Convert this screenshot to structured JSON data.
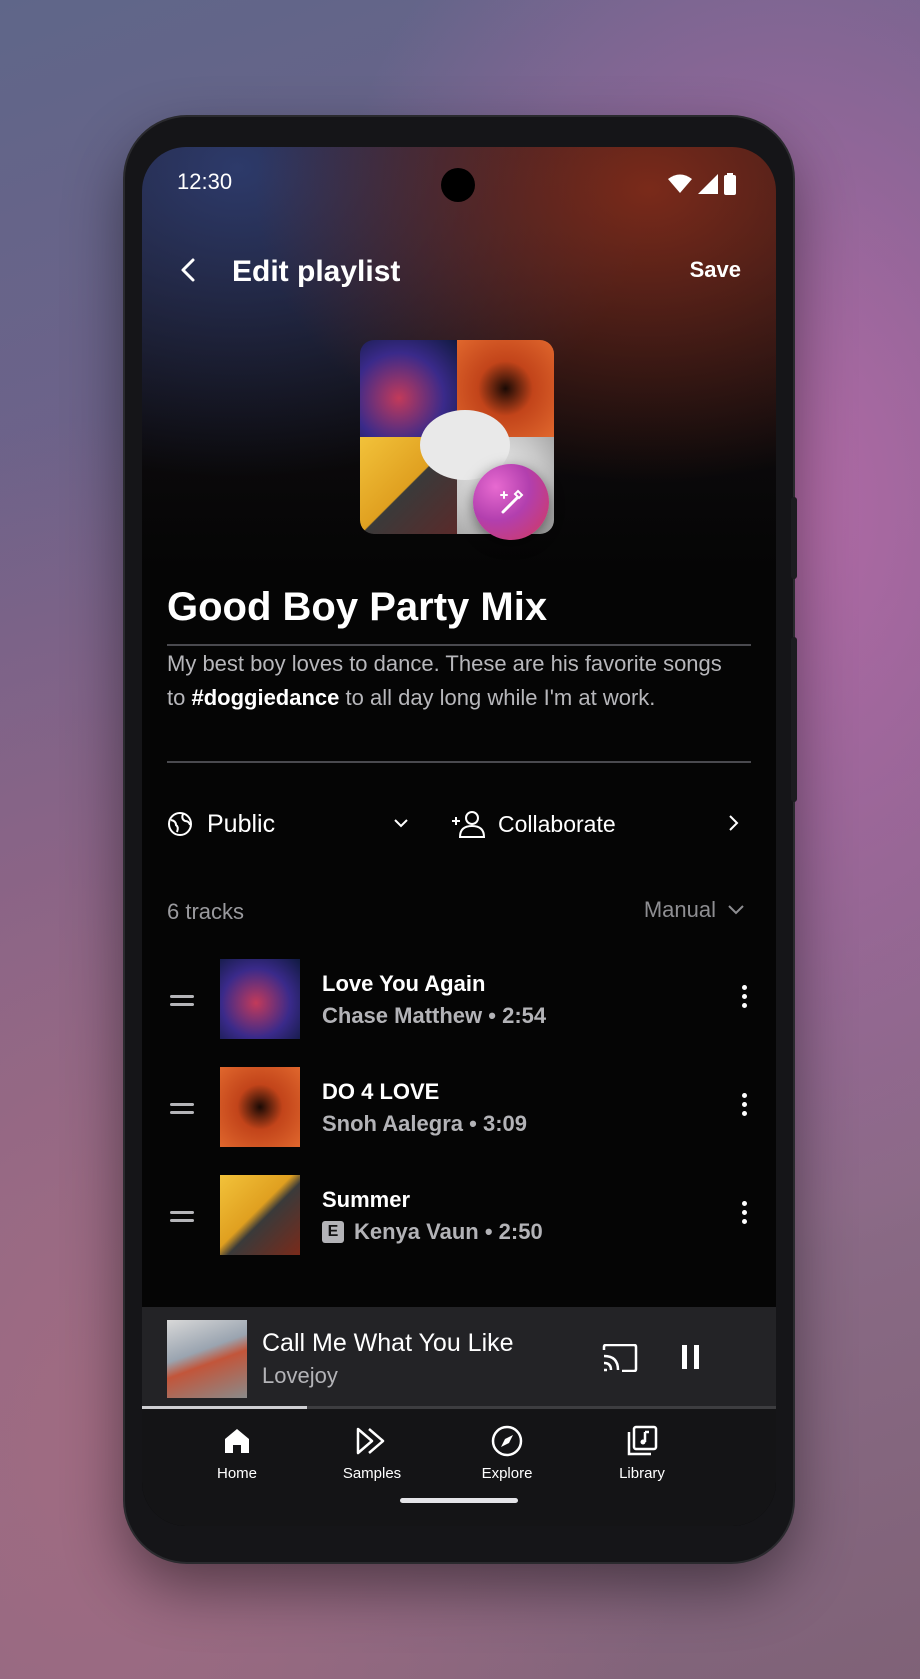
{
  "status_bar": {
    "time": "12:30"
  },
  "header": {
    "title": "Edit playlist",
    "save_label": "Save"
  },
  "playlist": {
    "name": "Good Boy Party Mix",
    "description_before": "My best boy loves to dance. These are his favorite songs to ",
    "description_tag": "#doggiedance",
    "description_after": " to all day long while I'm at work."
  },
  "privacy": {
    "label": "Public"
  },
  "collaborate": {
    "label": "Collaborate"
  },
  "tracks_header": {
    "count_label": "6 tracks",
    "sort_label": "Manual"
  },
  "tracks": [
    {
      "title": "Love You Again",
      "artist": "Chase Matthew",
      "duration": "2:54",
      "explicit": false
    },
    {
      "title": "DO 4 LOVE",
      "artist": "Snoh Aalegra",
      "duration": "3:09",
      "explicit": false
    },
    {
      "title": "Summer",
      "artist": "Kenya Vaun",
      "duration": "2:50",
      "explicit": true,
      "explicit_badge": "E"
    }
  ],
  "separator": "•",
  "now_playing": {
    "title": "Call Me What You Like",
    "artist": "Lovejoy",
    "progress": 0.26
  },
  "nav": [
    {
      "label": "Home",
      "icon": "home-icon"
    },
    {
      "label": "Samples",
      "icon": "samples-icon"
    },
    {
      "label": "Explore",
      "icon": "compass-icon"
    },
    {
      "label": "Library",
      "icon": "library-icon"
    }
  ]
}
